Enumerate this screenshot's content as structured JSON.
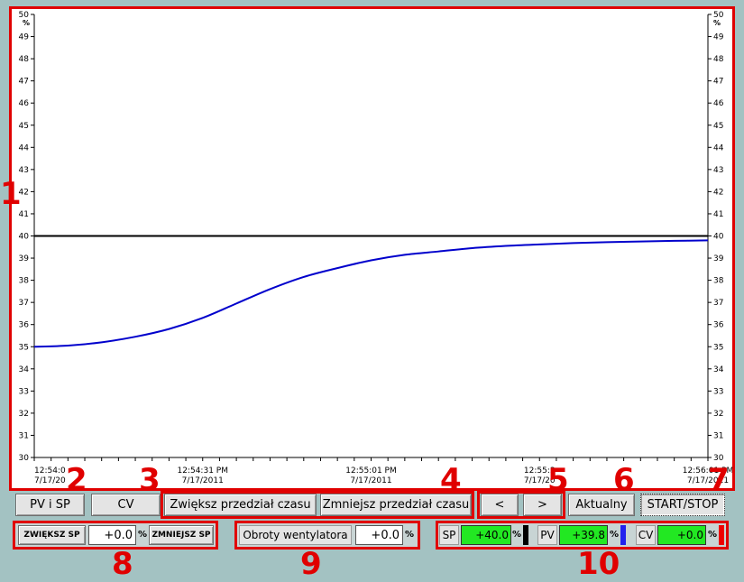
{
  "chart_data": {
    "type": "line",
    "y_ticks": [
      "30",
      "31",
      "32",
      "33",
      "34",
      "35",
      "36",
      "37",
      "38",
      "39",
      "40",
      "41",
      "42",
      "43",
      "44",
      "45",
      "46",
      "47",
      "48",
      "49",
      "50"
    ],
    "y_unit": "%",
    "ylim": [
      30,
      50
    ],
    "x_labels": [
      {
        "time": "12:54:0",
        "date": "7/17/20"
      },
      {
        "time": "12:54:31 PM",
        "date": "7/17/2011"
      },
      {
        "time": "12:55:01 PM",
        "date": "7/17/2011"
      },
      {
        "time": "12:55:3",
        "date": "7/17/20"
      },
      {
        "time": "12:56:01 PM",
        "date": "7/17/2011"
      }
    ],
    "series": [
      {
        "color": "#000000",
        "x": [
          0,
          1
        ],
        "y": [
          40.0,
          40.0
        ]
      },
      {
        "color": "#0000cc",
        "x": [
          0,
          0.05,
          0.1,
          0.15,
          0.2,
          0.25,
          0.3,
          0.35,
          0.4,
          0.45,
          0.5,
          0.55,
          0.6,
          0.65,
          0.7,
          0.75,
          0.8,
          0.85,
          0.9,
          0.95,
          1
        ],
        "y": [
          35.0,
          35.05,
          35.2,
          35.45,
          35.8,
          36.3,
          36.95,
          37.6,
          38.15,
          38.55,
          38.9,
          39.15,
          39.3,
          39.45,
          39.55,
          39.62,
          39.68,
          39.72,
          39.75,
          39.78,
          39.8
        ]
      }
    ]
  },
  "annotations": [
    "1",
    "2",
    "3",
    "4",
    "5",
    "6",
    "7",
    "8",
    "9",
    "10"
  ],
  "buttons": {
    "pv_sp": "PV i SP",
    "cv": "CV",
    "zoom_in": "Zwiększ przedział czasu",
    "zoom_out": "Zmniejsz przedział czasu",
    "prev": "<",
    "next": ">",
    "current": "Aktualny",
    "start_stop": "START/STOP",
    "increase_sp": "ZWIĘKSZ SP",
    "decrease_sp": "ZMNIEJSZ SP"
  },
  "sp_control": {
    "value": "+0.0",
    "unit": "%"
  },
  "fan": {
    "label": "Obroty wentylatora",
    "value": "+0.0",
    "unit": "%"
  },
  "readouts": {
    "sp": {
      "label": "SP",
      "value": "+40.0",
      "unit": "%",
      "bar_color": "#000000"
    },
    "pv": {
      "label": "PV",
      "value": "+39.8",
      "unit": "%",
      "bar_color": "#2222ee"
    },
    "cv": {
      "label": "CV",
      "value": "+0.0",
      "unit": "%",
      "bar_color": "#ee0000"
    }
  }
}
